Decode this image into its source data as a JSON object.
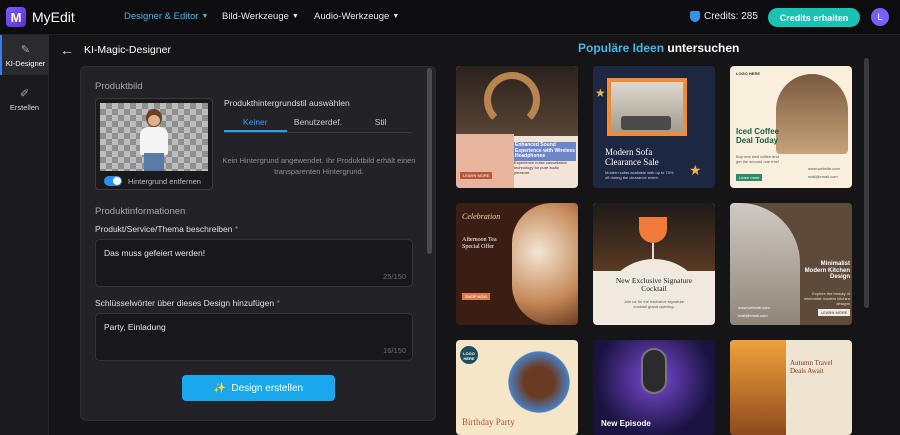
{
  "app": {
    "name": "MyEdit",
    "logo_letter": "M"
  },
  "nav": [
    {
      "label": "Designer & Editor",
      "active": true
    },
    {
      "label": "Bild-Werkzeuge",
      "active": false
    },
    {
      "label": "Audio-Werkzeuge",
      "active": false
    }
  ],
  "credits": {
    "label": "Credits: 285",
    "button": "Credits erhalten"
  },
  "user": {
    "initial": "L"
  },
  "rail": [
    {
      "label": "KI-Designer",
      "icon": "✎",
      "active": true
    },
    {
      "label": "Erstellen",
      "icon": "✐",
      "active": false
    }
  ],
  "page": {
    "title": "KI-Magic-Designer",
    "back_icon": "←"
  },
  "product": {
    "section_title": "Produktbild",
    "toggle_label": "Hintergrund entfernen",
    "bg_style_label": "Produkthintergrundstil auswählen",
    "tabs": [
      "Keiner",
      "Benutzerdef.",
      "Stil"
    ],
    "hint": "Kein Hintergrund angewendet. Ihr Produktbild erhält einen transparenten Hintergrund."
  },
  "info": {
    "section_title": "Produktinformationen",
    "desc_label": "Produkt/Service/Thema beschreiben",
    "desc_value": "Das muss gefeiert werden!",
    "desc_counter": "25/150",
    "kw_label": "Schlüsselwörter über dieses Design hinzufügen",
    "kw_value": "Party, Einladung",
    "kw_counter": "16/150",
    "required_mark": "*",
    "create_button": "Design erstellen",
    "create_icon": "✨"
  },
  "gallery": {
    "title_accent": "Populäre Ideen",
    "title_rest": " untersuchen",
    "cards": [
      {
        "title": "Enhanced Sound Experience with Wireless Headphones",
        "sub": "Experience noise cancellation technology for pure audio pleasure.",
        "cta": "LEARN MORE"
      },
      {
        "title": "Modern Sofa Clearance Sale",
        "sub": "Modern sofas available with up to 70% off during the clearance event."
      },
      {
        "title": "Iced Coffee Deal Today",
        "logo": "LOGO HERE",
        "sub": "Buy one iced coffee and get the second one free!",
        "cta": "Learn more",
        "site": "www.website.com",
        "mail": "mail@email.com"
      },
      {
        "script": "Celebration",
        "title": "Afternoon Tea Special Offer",
        "cta": "SHOP NOW"
      },
      {
        "title": "New Exclusive Signature Cocktail",
        "sub": "Join us for the exclusive signature cocktail grand opening."
      },
      {
        "title": "Minimalist Modern Kitchen Design",
        "sub": "Explore the beauty of minimalist modern kitchen designs",
        "cta": "LEARN MORE",
        "site": "www.website.com",
        "mail": "mail@email.com"
      },
      {
        "title": "Birthday Party",
        "logo": "LOGO HERE"
      },
      {
        "title": "New Episode"
      },
      {
        "title": "Autumn Travel Deals Await"
      }
    ]
  },
  "colors": {
    "accent": "#1aa8ec",
    "teal": "#19c3b4",
    "brand": "#7b5cff"
  }
}
